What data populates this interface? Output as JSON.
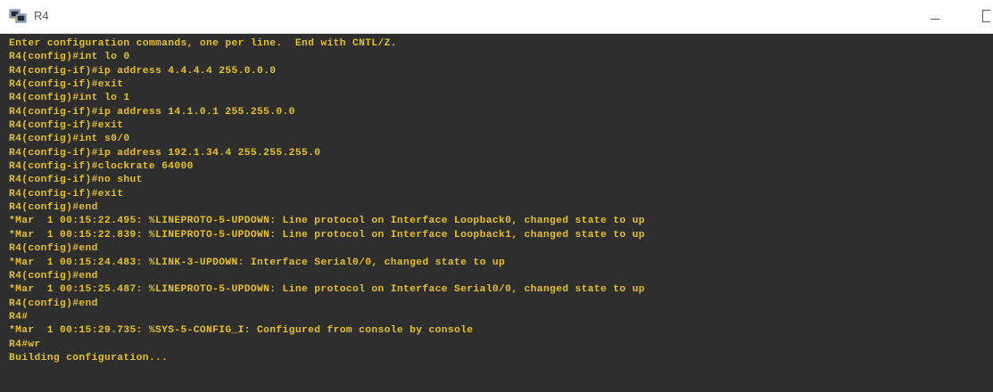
{
  "window": {
    "title": "R4",
    "minimize_glyph": "—",
    "maximize_glyph": "□"
  },
  "colors": {
    "terminal_background": "#2e2e2e",
    "terminal_text": "#e6c02a",
    "titlebar_background": "#ffffff"
  },
  "icons": {
    "app": "putty-terminal-icon"
  },
  "terminal": {
    "lines": [
      "Enter configuration commands, one per line.  End with CNTL/Z.",
      "R4(config)#int lo 0",
      "R4(config-if)#ip address 4.4.4.4 255.0.0.0",
      "R4(config-if)#exit",
      "R4(config)#int lo 1",
      "R4(config-if)#ip address 14.1.0.1 255.255.0.0",
      "R4(config-if)#exit",
      "R4(config)#int s0/0",
      "R4(config-if)#ip address 192.1.34.4 255.255.255.0",
      "R4(config-if)#clockrate 64000",
      "R4(config-if)#no shut",
      "R4(config-if)#exit",
      "R4(config)#end",
      "*Mar  1 00:15:22.495: %LINEPROTO-5-UPDOWN: Line protocol on Interface Loopback0, changed state to up",
      "*Mar  1 00:15:22.839: %LINEPROTO-5-UPDOWN: Line protocol on Interface Loopback1, changed state to up",
      "R4(config)#end",
      "*Mar  1 00:15:24.483: %LINK-3-UPDOWN: Interface Serial0/0, changed state to up",
      "R4(config)#end",
      "*Mar  1 00:15:25.487: %LINEPROTO-5-UPDOWN: Line protocol on Interface Serial0/0, changed state to up",
      "R4(config)#end",
      "R4#",
      "*Mar  1 00:15:29.735: %SYS-5-CONFIG_I: Configured from console by console",
      "R4#wr",
      "Building configuration..."
    ]
  }
}
